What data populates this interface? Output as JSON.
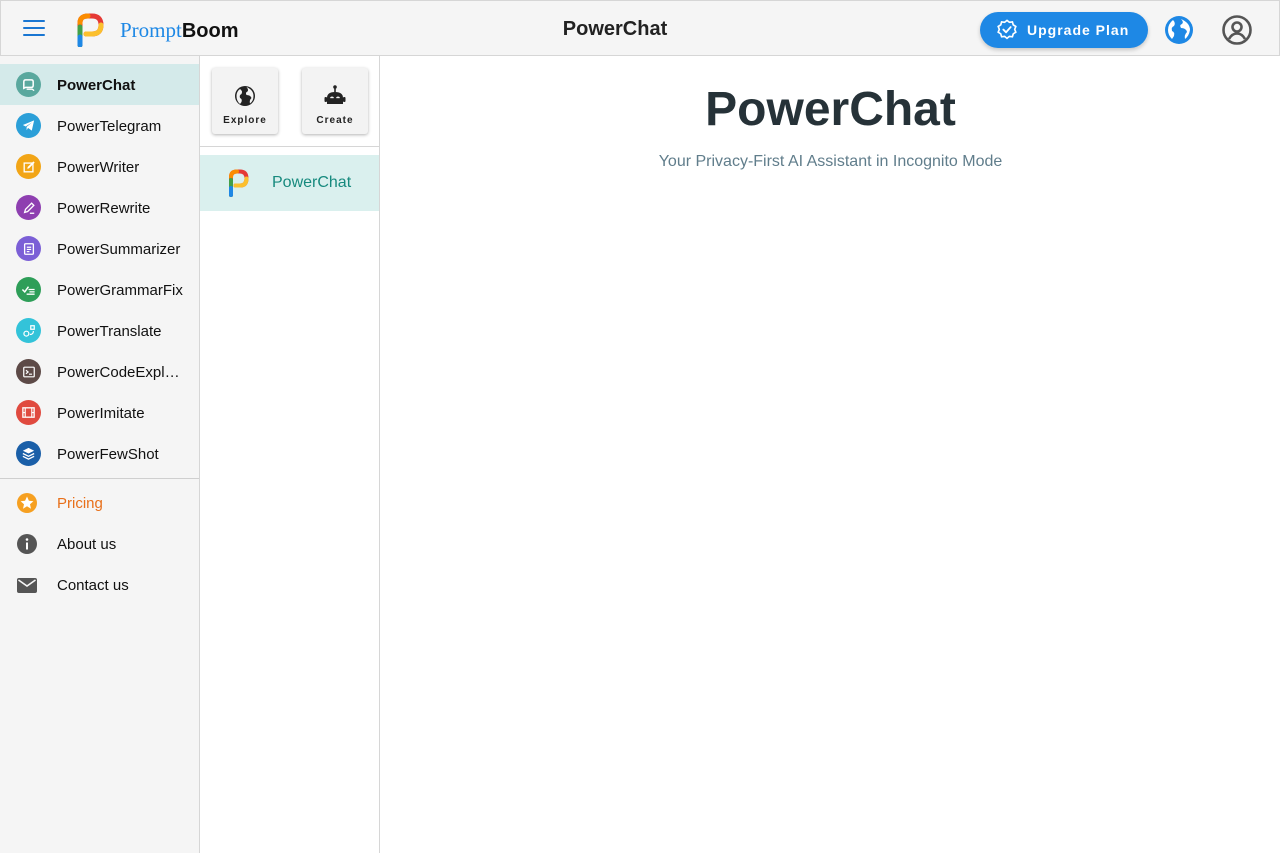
{
  "header": {
    "brand_prefix": "Prompt",
    "brand_suffix": "Boom",
    "app_title": "PowerChat",
    "upgrade_label": "Upgrade Plan"
  },
  "sidebar": {
    "items": [
      {
        "label": "PowerChat",
        "icon": "chat-icon",
        "color": "#5aa89e",
        "active": true
      },
      {
        "label": "PowerTelegram",
        "icon": "telegram-icon",
        "color": "#2b9fd8"
      },
      {
        "label": "PowerWriter",
        "icon": "edit-icon",
        "color": "#f2a516"
      },
      {
        "label": "PowerRewrite",
        "icon": "pen-icon",
        "color": "#8e3fb0"
      },
      {
        "label": "PowerSummarizer",
        "icon": "document-icon",
        "color": "#7b5fd6"
      },
      {
        "label": "PowerGrammarFix",
        "icon": "grammar-check-icon",
        "color": "#2e9e58"
      },
      {
        "label": "PowerTranslate",
        "icon": "translate-icon",
        "color": "#33c3d9"
      },
      {
        "label": "PowerCodeExpla…",
        "icon": "terminal-icon",
        "color": "#5d4a47"
      },
      {
        "label": "PowerImitate",
        "icon": "film-icon",
        "color": "#e04a3f"
      },
      {
        "label": "PowerFewShot",
        "icon": "layers-icon",
        "color": "#1a5fa8"
      }
    ],
    "secondary": [
      {
        "label": "Pricing",
        "icon": "star-icon",
        "color": "#f6a021"
      },
      {
        "label": "About us",
        "icon": "info-icon",
        "color": "#555555"
      },
      {
        "label": "Contact us",
        "icon": "mail-icon",
        "color": "#555555"
      }
    ]
  },
  "middle": {
    "tiles": [
      {
        "label": "Explore",
        "icon": "globe-icon"
      },
      {
        "label": "Create",
        "icon": "robot-icon"
      }
    ],
    "bots": [
      {
        "label": "PowerChat"
      }
    ]
  },
  "main": {
    "title": "PowerChat",
    "subtitle": "Your Privacy-First AI Assistant in Incognito Mode"
  },
  "colors": {
    "accent": "#1e88e5",
    "active_bg": "#d4eaea",
    "teal_text": "#178a7e",
    "pricing": "#e8701a"
  }
}
